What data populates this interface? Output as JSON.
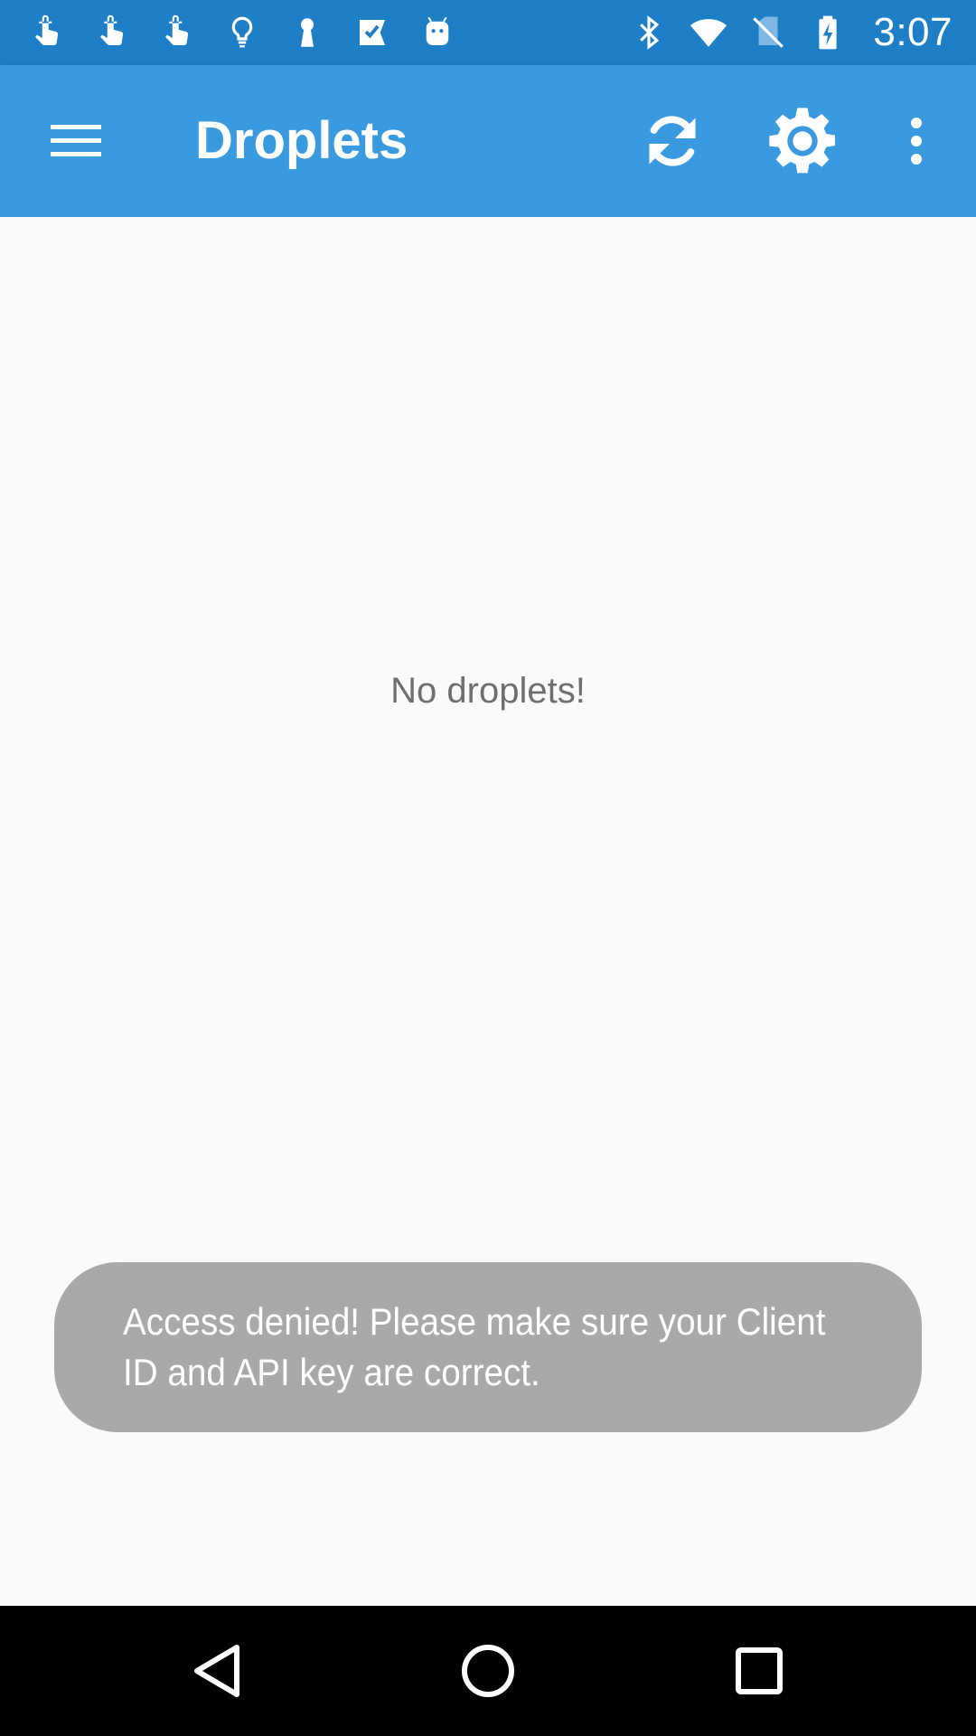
{
  "status_bar": {
    "time": "3:07",
    "left_icons": [
      "touch-hand-icon",
      "touch-hand-icon",
      "touch-hand-icon",
      "lightbulb-icon",
      "keyhole-icon",
      "checkmark-flag-icon",
      "android-robot-icon"
    ],
    "right_icons": [
      "bluetooth-icon",
      "wifi-icon",
      "no-sim-icon",
      "battery-charging-icon"
    ]
  },
  "app_bar": {
    "title": "Droplets",
    "actions": [
      "refresh-icon",
      "gear-icon",
      "more-vertical-icon"
    ]
  },
  "main": {
    "empty_message": "No droplets!"
  },
  "toast": {
    "message": "Access denied! Please make sure your Client ID and API key are correct."
  },
  "nav_bar": {
    "buttons": [
      "back-triangle-icon",
      "home-circle-icon",
      "recents-square-icon"
    ]
  },
  "colors": {
    "status_bar": "#1e7fc6",
    "app_bar": "#3a9ae0",
    "background": "#fafafa",
    "toast": "#a9a9a9",
    "nav_bar": "#000000"
  }
}
